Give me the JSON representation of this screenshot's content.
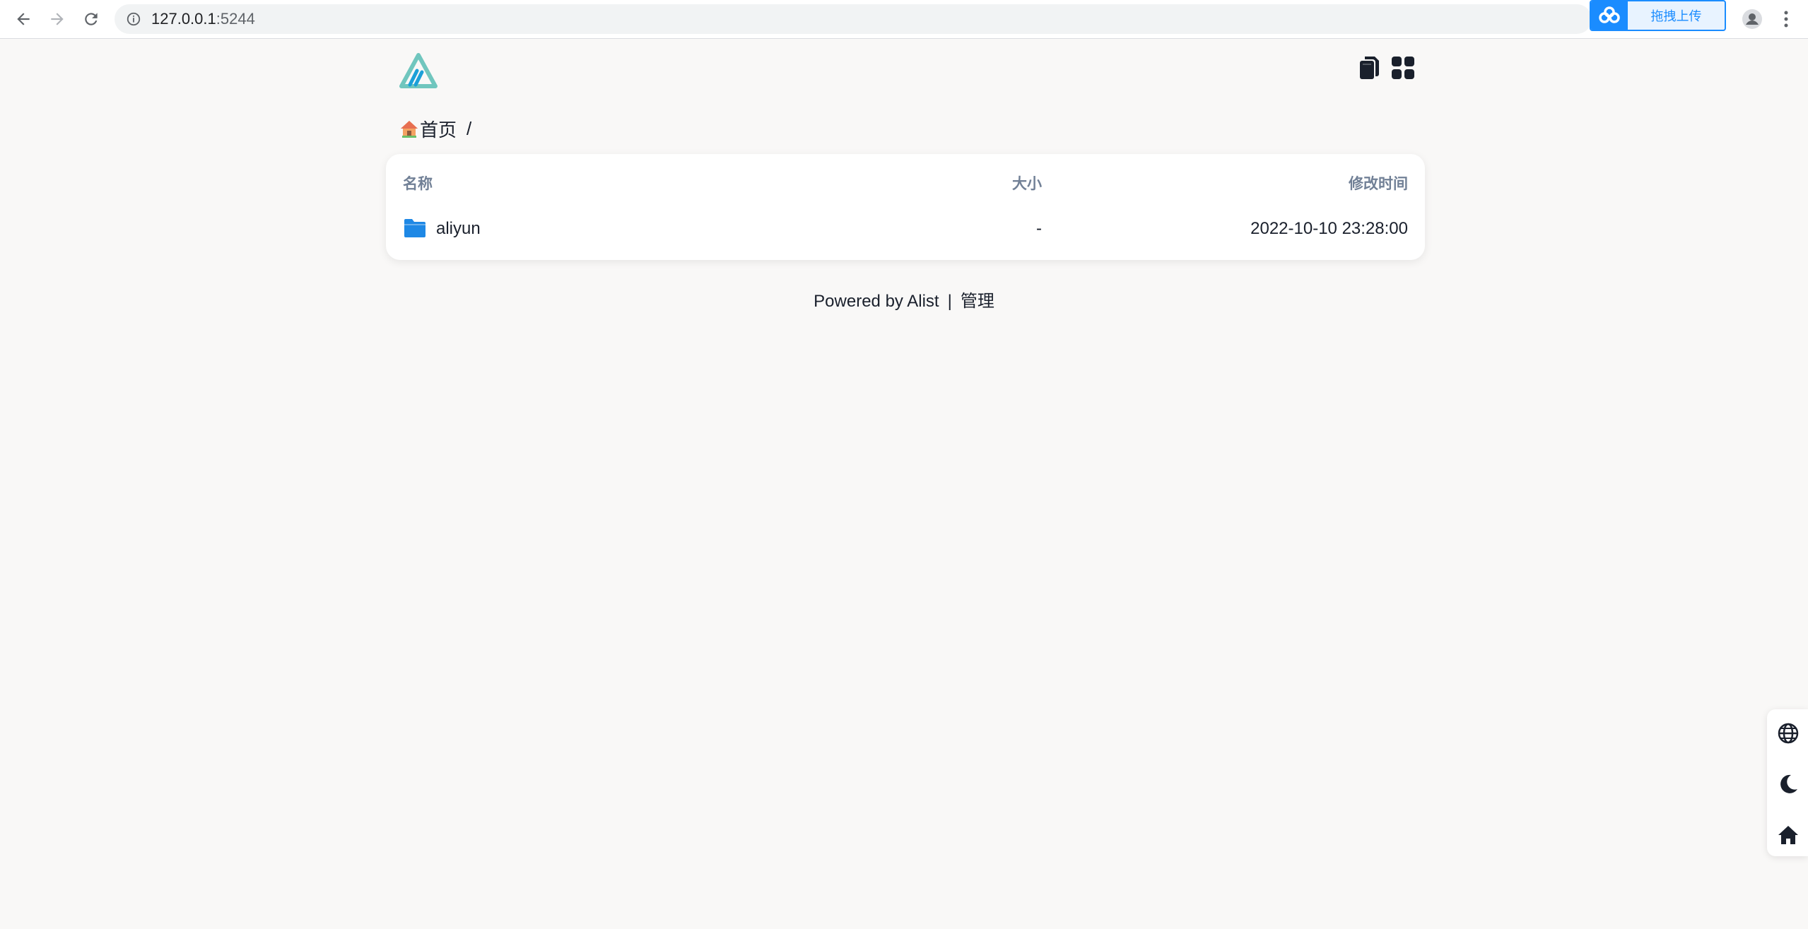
{
  "browser": {
    "url_host": "127.0.0.1",
    "url_port": ":5244",
    "extension_label": "拖拽上传"
  },
  "breadcrumb": {
    "home_label": "首页",
    "separator": "/"
  },
  "table": {
    "headers": {
      "name": "名称",
      "size": "大小",
      "modified": "修改时间"
    },
    "rows": [
      {
        "name": "aliyun",
        "size": "-",
        "modified": "2022-10-10 23:28:00",
        "type": "folder"
      }
    ]
  },
  "footer": {
    "powered_by": "Powered by Alist",
    "separator": "|",
    "manage_label": "管理"
  },
  "colors": {
    "page_bg": "#f9f8f7",
    "folder_blue": "#1e88e5",
    "logo_teal": "#70c6be",
    "logo_blue": "#1ba0d8",
    "header_gray": "#718096"
  },
  "icons": {
    "header_actions": [
      "copy-icon",
      "grid-view-icon"
    ],
    "side_tools": [
      "globe-icon",
      "moon-icon",
      "home-icon"
    ]
  }
}
